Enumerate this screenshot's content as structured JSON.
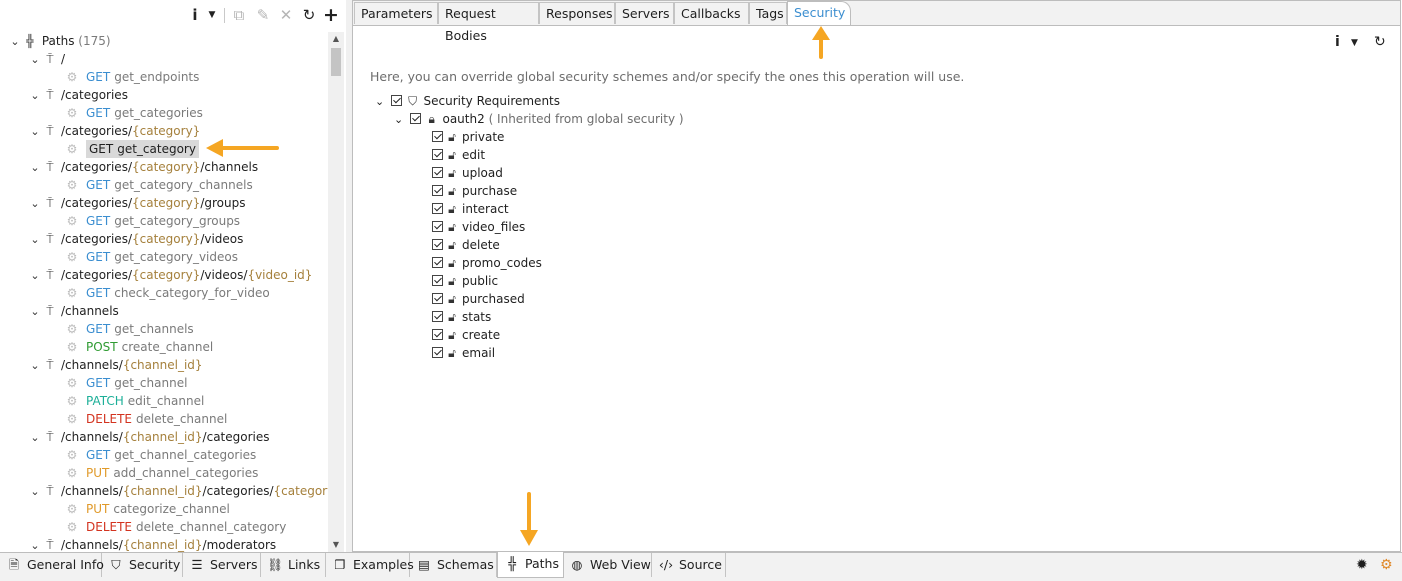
{
  "left_panel": {
    "root": {
      "label": "Paths",
      "count": "(175)"
    },
    "rows": [
      {
        "kind": "path",
        "parts": [
          {
            "t": "/",
            "p": false
          }
        ]
      },
      {
        "kind": "op",
        "method": "GET",
        "name": "get_endpoints"
      },
      {
        "kind": "path",
        "parts": [
          {
            "t": "/categories",
            "p": false
          }
        ]
      },
      {
        "kind": "op",
        "method": "GET",
        "name": "get_categories"
      },
      {
        "kind": "path",
        "parts": [
          {
            "t": "/categories/",
            "p": false
          },
          {
            "t": "{category}",
            "p": true
          }
        ]
      },
      {
        "kind": "op",
        "method": "GET",
        "name": "get_category",
        "selected": true
      },
      {
        "kind": "path",
        "parts": [
          {
            "t": "/categories/",
            "p": false
          },
          {
            "t": "{category}",
            "p": true
          },
          {
            "t": "/channels",
            "p": false
          }
        ]
      },
      {
        "kind": "op",
        "method": "GET",
        "name": "get_category_channels"
      },
      {
        "kind": "path",
        "parts": [
          {
            "t": "/categories/",
            "p": false
          },
          {
            "t": "{category}",
            "p": true
          },
          {
            "t": "/groups",
            "p": false
          }
        ]
      },
      {
        "kind": "op",
        "method": "GET",
        "name": "get_category_groups"
      },
      {
        "kind": "path",
        "parts": [
          {
            "t": "/categories/",
            "p": false
          },
          {
            "t": "{category}",
            "p": true
          },
          {
            "t": "/videos",
            "p": false
          }
        ]
      },
      {
        "kind": "op",
        "method": "GET",
        "name": "get_category_videos"
      },
      {
        "kind": "path",
        "parts": [
          {
            "t": "/categories/",
            "p": false
          },
          {
            "t": "{category}",
            "p": true
          },
          {
            "t": "/videos/",
            "p": false
          },
          {
            "t": "{video_id}",
            "p": true
          }
        ]
      },
      {
        "kind": "op",
        "method": "GET",
        "name": "check_category_for_video"
      },
      {
        "kind": "path",
        "parts": [
          {
            "t": "/channels",
            "p": false
          }
        ]
      },
      {
        "kind": "op",
        "method": "GET",
        "name": "get_channels"
      },
      {
        "kind": "op",
        "method": "POST",
        "name": "create_channel"
      },
      {
        "kind": "path",
        "parts": [
          {
            "t": "/channels/",
            "p": false
          },
          {
            "t": "{channel_id}",
            "p": true
          }
        ]
      },
      {
        "kind": "op",
        "method": "GET",
        "name": "get_channel"
      },
      {
        "kind": "op",
        "method": "PATCH",
        "name": "edit_channel"
      },
      {
        "kind": "op",
        "method": "DELETE",
        "name": "delete_channel"
      },
      {
        "kind": "path",
        "parts": [
          {
            "t": "/channels/",
            "p": false
          },
          {
            "t": "{channel_id}",
            "p": true
          },
          {
            "t": "/categories",
            "p": false
          }
        ]
      },
      {
        "kind": "op",
        "method": "GET",
        "name": "get_channel_categories"
      },
      {
        "kind": "op",
        "method": "PUT",
        "name": "add_channel_categories"
      },
      {
        "kind": "path",
        "parts": [
          {
            "t": "/channels/",
            "p": false
          },
          {
            "t": "{channel_id}",
            "p": true
          },
          {
            "t": "/categories/",
            "p": false
          },
          {
            "t": "{category}",
            "p": true
          }
        ]
      },
      {
        "kind": "op",
        "method": "PUT",
        "name": "categorize_channel"
      },
      {
        "kind": "op",
        "method": "DELETE",
        "name": "delete_channel_category"
      },
      {
        "kind": "path",
        "parts": [
          {
            "t": "/channels/",
            "p": false
          },
          {
            "t": "{channel_id}",
            "p": true
          },
          {
            "t": "/moderators",
            "p": false
          }
        ]
      }
    ]
  },
  "top_tabs": [
    {
      "label": "Parameters"
    },
    {
      "label": "Request Bodies"
    },
    {
      "label": "Responses"
    },
    {
      "label": "Servers"
    },
    {
      "label": "Callbacks"
    },
    {
      "label": "Tags"
    },
    {
      "label": "Security",
      "active": true
    }
  ],
  "security": {
    "description": "Here, you can override global security schemes and/or specify the ones this operation will use.",
    "requirements_label": "Security Requirements",
    "scheme": {
      "name": "oauth2",
      "note": "( Inherited from global security )"
    },
    "scopes": [
      "private",
      "edit",
      "upload",
      "purchase",
      "interact",
      "video_files",
      "delete",
      "promo_codes",
      "public",
      "purchased",
      "stats",
      "create",
      "email"
    ]
  },
  "bottom_tabs": [
    {
      "label": "General Info",
      "icon": "document-icon"
    },
    {
      "label": "Security",
      "icon": "shield-icon"
    },
    {
      "label": "Servers",
      "icon": "server-icon"
    },
    {
      "label": "Links",
      "icon": "link-icon"
    },
    {
      "label": "Examples",
      "icon": "examples-icon"
    },
    {
      "label": "Schemas",
      "icon": "schemas-icon"
    },
    {
      "label": "Paths",
      "icon": "paths-icon",
      "active": true
    },
    {
      "label": "Web View",
      "icon": "globe-icon"
    },
    {
      "label": "Source",
      "icon": "code-icon"
    }
  ],
  "colors": {
    "GET": "#3b8ed0",
    "POST": "#2f9b32",
    "PATCH": "#1caf98",
    "DELETE": "#d3331f",
    "PUT": "#e09a2a",
    "param": "#a5803c",
    "accent": "#3b8ed0",
    "annotation_arrow": "#f5a623"
  }
}
